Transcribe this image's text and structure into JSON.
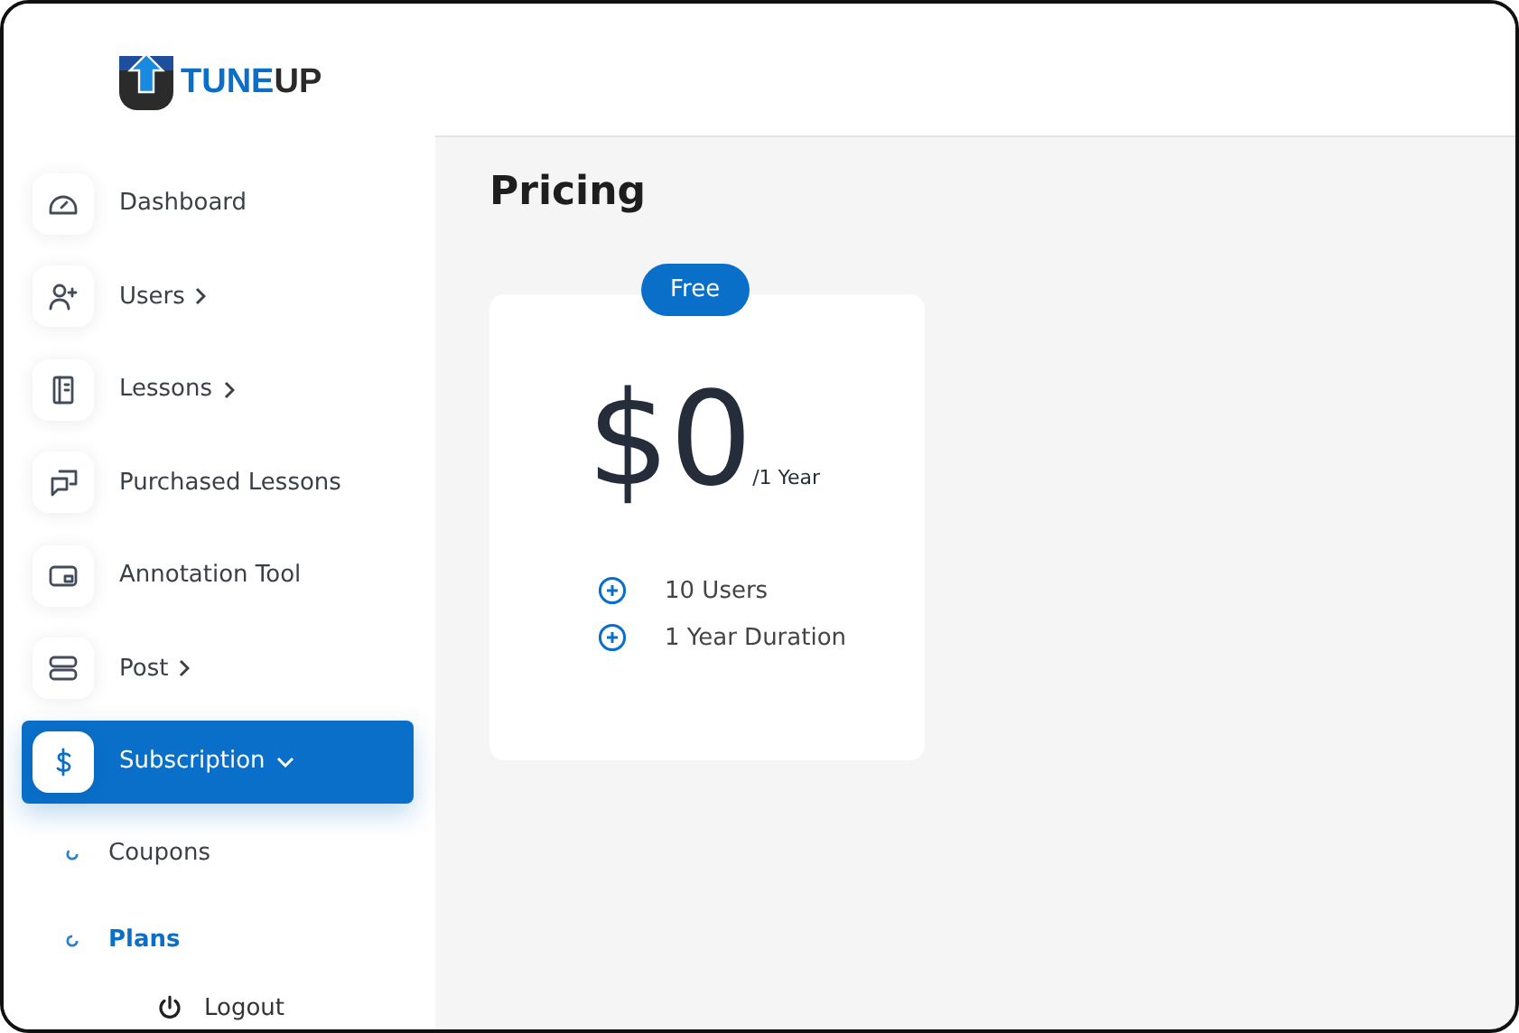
{
  "logo": {
    "parts": [
      {
        "text": "TUNE",
        "color": "#0a6fc9"
      },
      {
        "text": "UP",
        "color": "#2a2a2a"
      }
    ]
  },
  "nav": [
    {
      "label": "Dashboard",
      "kind": "link",
      "selected": false
    },
    {
      "label": "Users",
      "kind": "menu",
      "expanded": false,
      "selected": false
    },
    {
      "label": "Lessons",
      "kind": "menu",
      "expanded": false,
      "selected": false
    },
    {
      "label": "Purchased Lessons",
      "kind": "link",
      "selected": false
    },
    {
      "label": "Annotation Tool",
      "kind": "link",
      "selected": false
    },
    {
      "label": "Post",
      "kind": "menu",
      "expanded": false,
      "selected": false
    },
    {
      "label": "Subscription",
      "kind": "menu",
      "expanded": true,
      "selected": true,
      "children": [
        {
          "label": "Coupons",
          "selected": false
        },
        {
          "label": "Plans",
          "selected": true
        }
      ]
    }
  ],
  "logout": {
    "label": "Logout"
  },
  "page_title": "Pricing",
  "plans": [
    {
      "badge": "Free",
      "price": "$0",
      "period": "/1 Year",
      "features": [
        "10 Users",
        "1 Year Duration"
      ]
    }
  ]
}
